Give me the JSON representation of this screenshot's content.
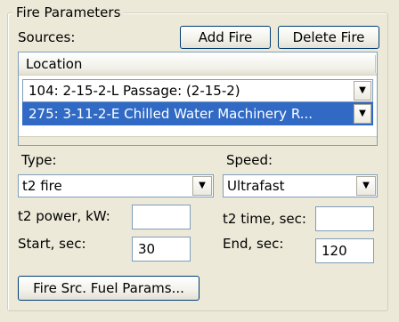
{
  "group": {
    "title": "Fire Parameters"
  },
  "sources": {
    "label": "Sources:",
    "add_button": "Add Fire",
    "delete_button": "Delete Fire"
  },
  "list": {
    "column_header": "Location",
    "rows": [
      {
        "text": "104: 2-15-2-L Passage: (2-15-2)",
        "selected": false
      },
      {
        "text": "275: 3-11-2-E Chilled Water Machinery R...",
        "selected": true
      }
    ]
  },
  "type": {
    "label": "Type:",
    "value": "t2 fire"
  },
  "speed": {
    "label": "Speed:",
    "value": "Ultrafast"
  },
  "t2_power": {
    "label": "t2 power, kW:",
    "value": ""
  },
  "t2_time": {
    "label": "t2 time, sec:",
    "value": ""
  },
  "start": {
    "label": "Start, sec:",
    "value": "30"
  },
  "end": {
    "label": "End, sec:",
    "value": "120"
  },
  "fuel_button": "Fire Src. Fuel Params...",
  "colors": {
    "selection": "#316AC5",
    "dialog_bg": "#ECE9D8",
    "border_blue": "#003C74"
  }
}
